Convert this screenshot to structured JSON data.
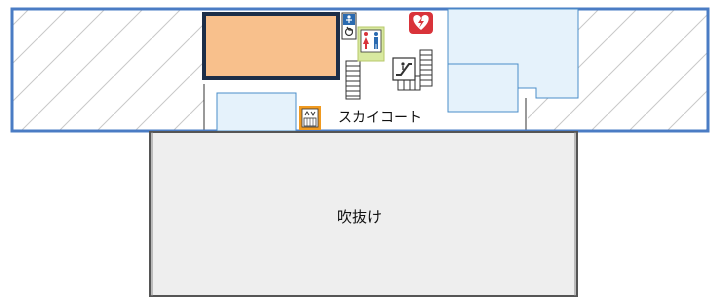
{
  "map": {
    "area_labels": {
      "sky_court": "スカイコート",
      "atrium": "吹抜け"
    },
    "colors": {
      "outer_wall": "#4a7cc4",
      "hatch": "#c8c8c8",
      "atrium_fill": "#eeeeee",
      "atrium_border": "#555555",
      "highlight_fill": "#f8c08c",
      "highlight_border": "#1c2e48",
      "shop_fill": "#e5f2fb",
      "shop_border": "#4a8ec8",
      "stair_stroke": "#333333",
      "aed_red": "#d9333a",
      "elevator_orange": "#f09a20"
    },
    "icons": [
      "wheelchair-restroom-icon",
      "restroom-icon",
      "escalator-icon",
      "aed-heart-icon",
      "elevator-icon",
      "stairs-icon"
    ]
  }
}
